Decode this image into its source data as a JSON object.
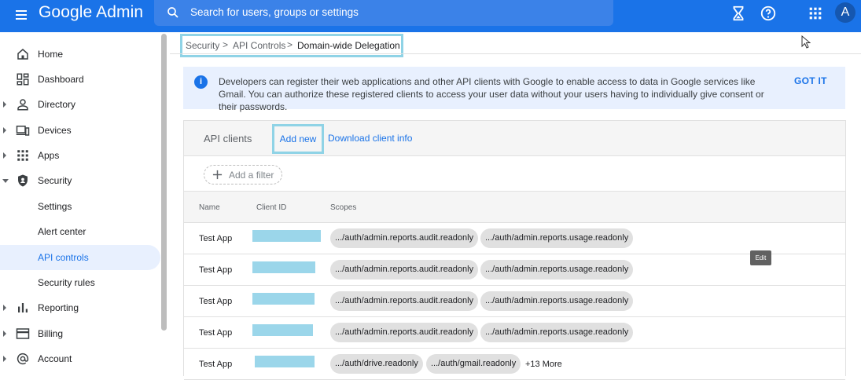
{
  "app": {
    "brand": "Google Admin"
  },
  "search": {
    "placeholder": "Search for users, groups or settings"
  },
  "header": {
    "avatar_letter": "A"
  },
  "sidebar": {
    "items": [
      {
        "label": "Home",
        "icon": "home-icon",
        "arrow": "none"
      },
      {
        "label": "Dashboard",
        "icon": "dashboard-icon",
        "arrow": "none"
      },
      {
        "label": "Directory",
        "icon": "person-icon",
        "arrow": "right"
      },
      {
        "label": "Devices",
        "icon": "devices-icon",
        "arrow": "right"
      },
      {
        "label": "Apps",
        "icon": "apps-grid-icon",
        "arrow": "right"
      },
      {
        "label": "Security",
        "icon": "shield-icon",
        "arrow": "down"
      },
      {
        "label": "Settings",
        "icon": "",
        "arrow": "none"
      },
      {
        "label": "Alert center",
        "icon": "",
        "arrow": "none"
      },
      {
        "label": "API controls",
        "icon": "",
        "arrow": "none",
        "active": true
      },
      {
        "label": "Security rules",
        "icon": "",
        "arrow": "none"
      },
      {
        "label": "Reporting",
        "icon": "bar-chart-icon",
        "arrow": "right"
      },
      {
        "label": "Billing",
        "icon": "credit-card-icon",
        "arrow": "right"
      },
      {
        "label": "Account",
        "icon": "at-sign-icon",
        "arrow": "right"
      }
    ]
  },
  "breadcrumb": {
    "items": [
      "Security",
      "API Controls",
      "Domain-wide Delegation"
    ],
    "separator": ">"
  },
  "banner": {
    "text": "Developers can register their web applications and other API clients with Google to enable access to data in Google services like Gmail. You can authorize these registered clients to access your user data without your users having to individually give consent or their passwords.",
    "action": "GOT IT"
  },
  "card": {
    "title": "API clients",
    "add_new": "Add new",
    "download": "Download client info",
    "add_filter": "Add a filter",
    "columns": [
      "Name",
      "Client ID",
      "Scopes"
    ],
    "rows": [
      {
        "name": "Test App",
        "scopes": [
          ".../auth/admin.reports.audit.readonly",
          ".../auth/admin.reports.usage.readonly"
        ],
        "more": ""
      },
      {
        "name": "Test App",
        "scopes": [
          ".../auth/admin.reports.audit.readonly",
          ".../auth/admin.reports.usage.readonly"
        ],
        "more": ""
      },
      {
        "name": "Test App",
        "scopes": [
          ".../auth/admin.reports.audit.readonly",
          ".../auth/admin.reports.usage.readonly"
        ],
        "more": ""
      },
      {
        "name": "Test App",
        "scopes": [
          ".../auth/admin.reports.audit.readonly",
          ".../auth/admin.reports.usage.readonly"
        ],
        "more": ""
      },
      {
        "name": "Test App",
        "scopes": [
          ".../auth/drive.readonly",
          ".../auth/gmail.readonly"
        ],
        "more": "+13 More"
      }
    ]
  },
  "tooltip": {
    "text": "Edit"
  },
  "colors": {
    "primary": "#1a73e8",
    "highlight_border": "#8fd3e6",
    "redacted": "#9bd6ea"
  }
}
